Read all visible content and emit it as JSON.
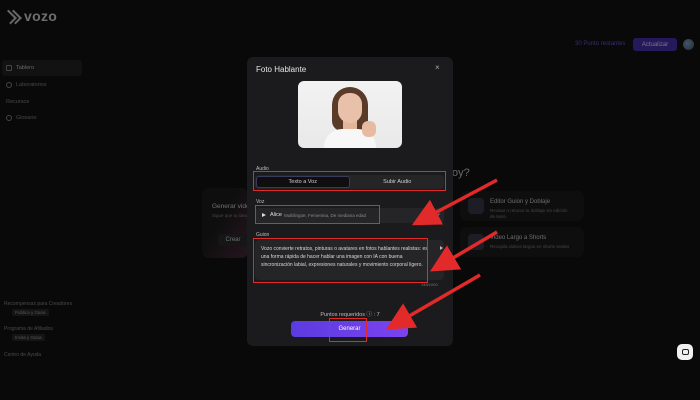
{
  "app": {
    "logo_text": "vozo",
    "points_link": "30 Punto restantes",
    "update_button": "Actualizar"
  },
  "sidebar": {
    "items": [
      {
        "label": "Tablero",
        "icon": "dashboard-icon",
        "active": true
      },
      {
        "label": "Laboratorios",
        "icon": "lab-icon",
        "active": false
      },
      {
        "label": "Recursos",
        "icon": "",
        "active": false
      },
      {
        "label": "Glosario",
        "icon": "glossary-icon",
        "active": false
      }
    ],
    "bottom": [
      {
        "label": "Recompensas para Creadores",
        "tag": "Publica y Gana"
      },
      {
        "label": "Programa de Afiliados",
        "tag": "Invita y Gana"
      },
      {
        "label": "Centro de Ayuda",
        "tag": ""
      }
    ]
  },
  "background": {
    "headline_fragment": "oy?",
    "generate_card": {
      "title": "Generar vide",
      "desc": "Sigue que tu idea",
      "button": "Crear"
    },
    "cards": [
      {
        "title": "Editor Guion y Doblaje",
        "desc": "Revisar o retocar tu doblaje sin edición de texto"
      },
      {
        "title": "Video Largo a Shorts",
        "desc": "Recopila videos largos en shorts virales"
      }
    ]
  },
  "modal": {
    "title": "Foto Hablante",
    "close": "×",
    "audio_label": "Audio",
    "audio_tabs": [
      "Texto a Voz",
      "Subir Audio"
    ],
    "voice_label": "Voz",
    "voice_name": "Alice",
    "voice_desc": "Multilingüe, Femenina, De mediana edad",
    "script_label": "Guion",
    "script_text": "Vozo convierte retratos, pinturas o avatares en fotos hablantes realistas: es una forma rápida de hacer hablar una imagen con IA con buena sincronización labial, expresiones naturales y movimiento corporal ligero.",
    "char_count": "148/1000",
    "points_needed": "Puntos requeridos ⓘ : 7",
    "generate_button": "Generar"
  },
  "colors": {
    "accent": "#5b3be0",
    "annotation": "#e32a2a"
  }
}
